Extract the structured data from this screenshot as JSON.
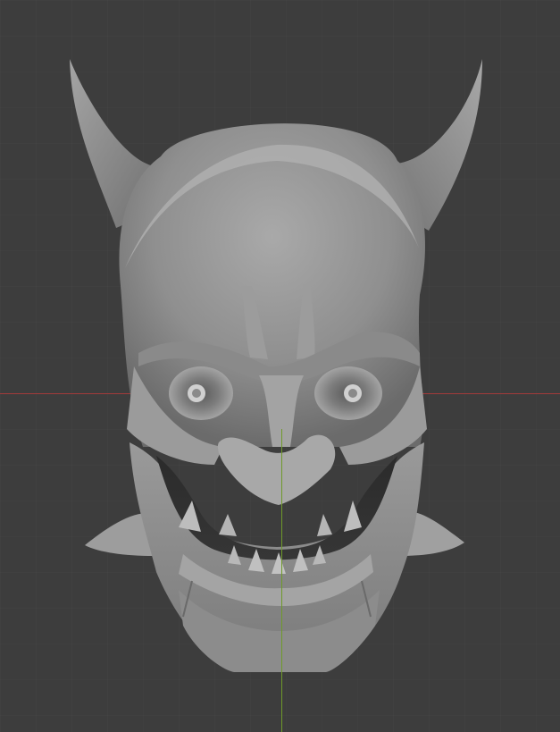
{
  "viewport": {
    "background": "#3d3d3d",
    "x_axis_color": "#a33a3a",
    "y_axis_color": "#6f9a2a",
    "mesh_color": "#8e8e8e",
    "mesh_highlight": "#b8b8b8",
    "mesh_shadow": "#5a5a5a",
    "model_icon": "oni-mask-icon"
  }
}
